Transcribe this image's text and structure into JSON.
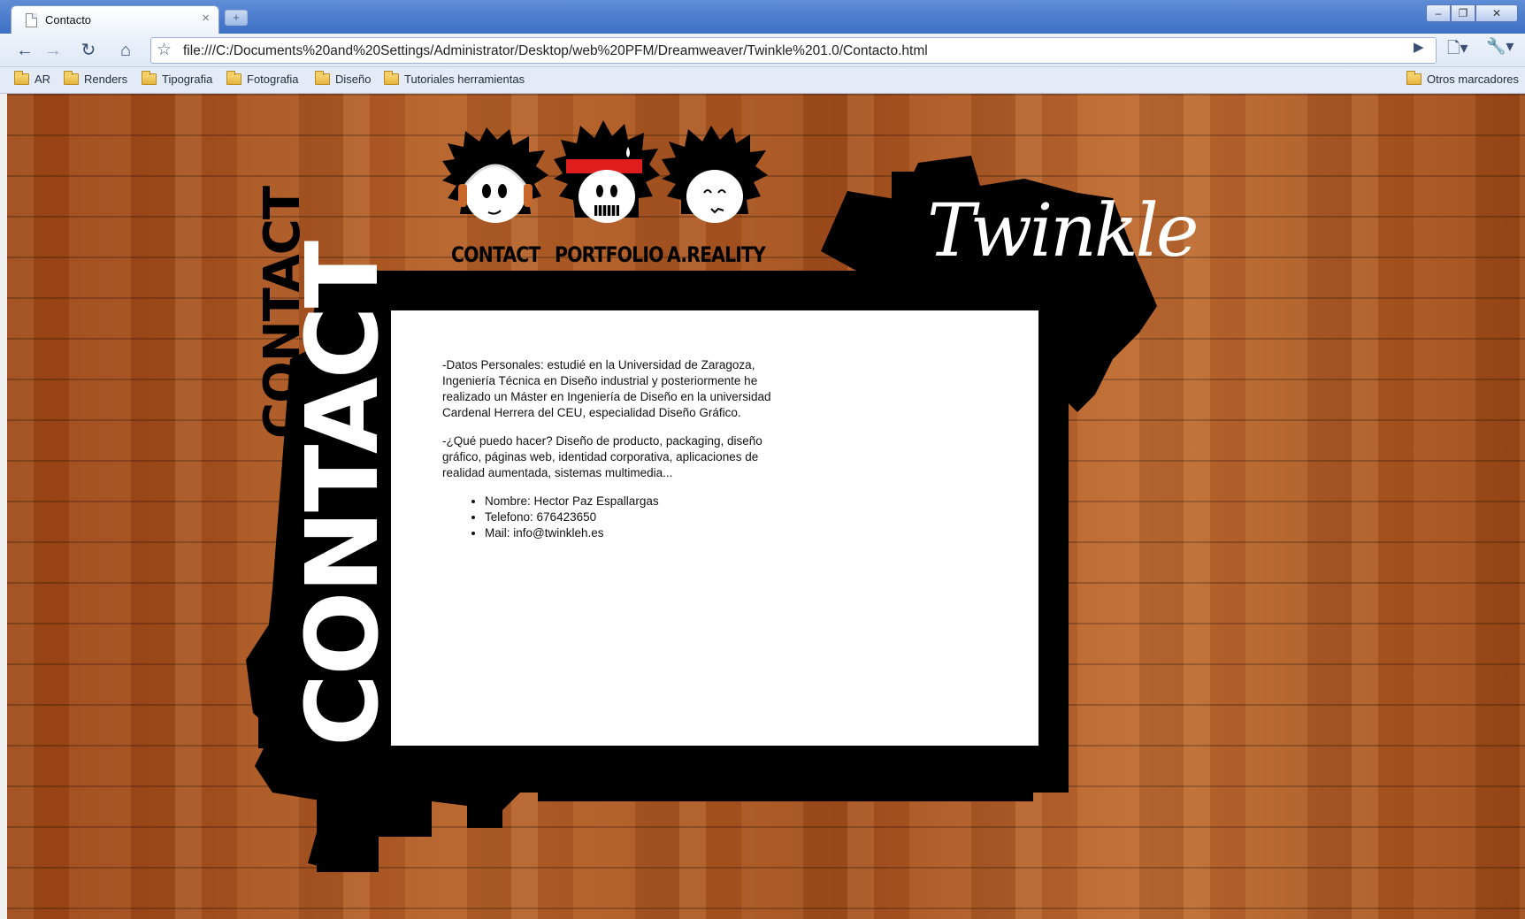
{
  "browser": {
    "tab_title": "Contacto",
    "tab_close": "×",
    "new_tab": "+",
    "window_buttons": {
      "minimize": "–",
      "maximize": "❐",
      "close": "✕"
    },
    "nav": {
      "back": "←",
      "forward": "→",
      "reload": "↻",
      "home": "⌂"
    },
    "url": "file:///C:/Documents%20and%20Settings/Administrator/Desktop/web%20PFM/Dreamweaver/Twinkle%201.0/Contacto.html",
    "bookmarks": [
      "AR",
      "Renders",
      "Tipografia",
      "Fotografia",
      "Diseño",
      "Tutoriales herramientas"
    ],
    "other_bookmarks": "Otros marcadores"
  },
  "page": {
    "nav_items": [
      "CONTACT",
      "PORTFOLIO",
      "A.REALITY"
    ],
    "logo": "Twinkle",
    "vertical_big": "CONTACT",
    "vertical_small": "CONTACT",
    "paragraphs": [
      "-Datos Personales: estudié en la Universidad de Zaragoza, Ingeniería Técnica en Diseño industrial y posteriormente he realizado un Máster en Ingeniería de Diseño en la universidad Cardenal Herrera del CEU, especialidad Diseño Gráfico.",
      "-¿Qué puedo hacer? Diseño de producto, packaging, diseño gráfico, páginas web, identidad corporativa, aplicaciones de realidad aumentada, sistemas multimedia..."
    ],
    "contact_list": [
      "Nombre: Hector Paz Espallargas",
      "Telefono: 676423650",
      "Mail: info@twinkleh.es"
    ]
  },
  "colors": {
    "wood": "#a8531f",
    "frame": "#000000",
    "headband": "#e01d1d",
    "headphones": "#c8682b"
  }
}
